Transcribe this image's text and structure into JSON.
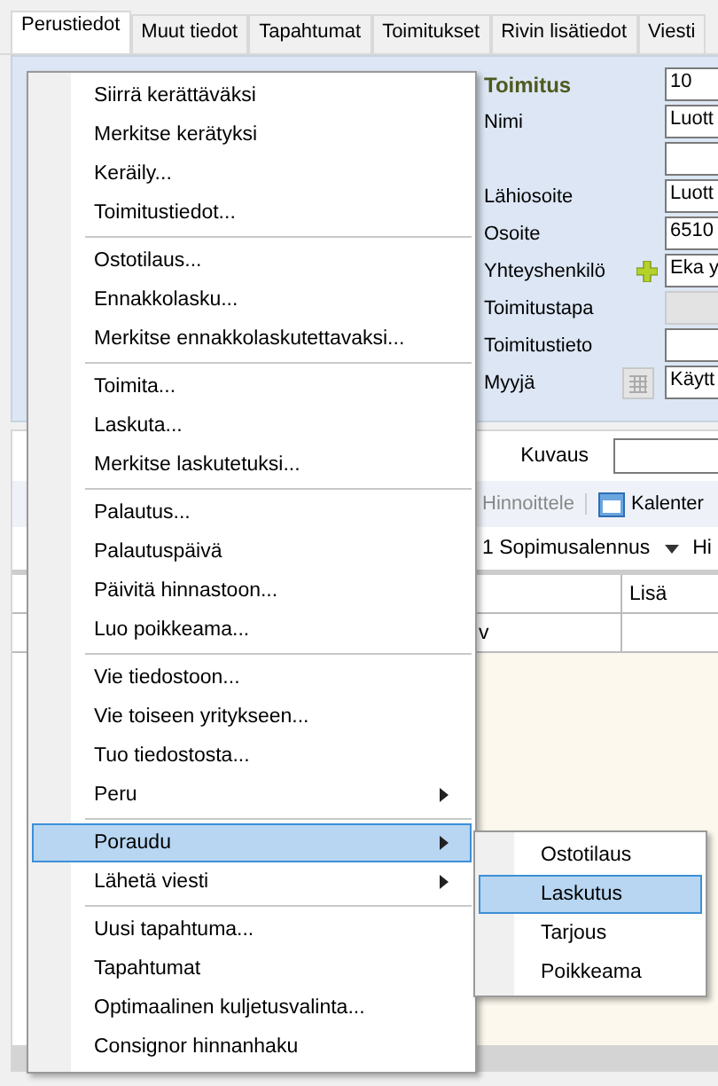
{
  "tabs": [
    {
      "label": "Perustiedot",
      "selected": true
    },
    {
      "label": "Muut tiedot",
      "selected": false
    },
    {
      "label": "Tapahtumat",
      "selected": false
    },
    {
      "label": "Toimitukset",
      "selected": false
    },
    {
      "label": "Rivin lisätiedot",
      "selected": false
    },
    {
      "label": "Viesti",
      "selected": false
    }
  ],
  "form": [
    {
      "label": "Toimitus",
      "kind": "heading",
      "value": "10"
    },
    {
      "label": "Nimi",
      "kind": "text",
      "value": "Luott"
    },
    {
      "kind": "text"
    },
    {
      "label": "Lähiosoite",
      "kind": "text",
      "value": "Luott"
    },
    {
      "label": "Osoite",
      "kind": "text",
      "value": "6510"
    },
    {
      "label": "Yhteyshenkilö",
      "kind": "add",
      "value": "Eka y"
    },
    {
      "label": "Toimitustapa",
      "kind": "disabled"
    },
    {
      "label": "Toimitustieto",
      "kind": "text"
    },
    {
      "label": "Myyjä",
      "kind": "picker",
      "value": "Käytt"
    }
  ],
  "description": {
    "label": "Kuvaus"
  },
  "toolbar": [
    {
      "label": "Hinnoittele",
      "kind": "disabled"
    },
    {
      "label": "Kalenter",
      "kind": "calendar"
    }
  ],
  "filter": {
    "value": "1 Sopimusalennus",
    "next": "Hi"
  },
  "grid": {
    "columns": [
      "Lisä"
    ],
    "rows": [
      [
        "v"
      ]
    ]
  },
  "menu": [
    {
      "kind": "item",
      "label": "Siirrä kerättäväksi",
      "selected": false
    },
    {
      "kind": "item",
      "label": "Merkitse kerätyksi",
      "selected": false
    },
    {
      "kind": "item",
      "label": "Keräily...",
      "selected": false
    },
    {
      "kind": "item",
      "label": "Toimitustiedot...",
      "selected": false
    },
    {
      "kind": "separator"
    },
    {
      "kind": "item",
      "label": "Ostotilaus...",
      "selected": false
    },
    {
      "kind": "item",
      "label": "Ennakkolasku...",
      "selected": false
    },
    {
      "kind": "item",
      "label": "Merkitse ennakkolaskutettavaksi...",
      "selected": false
    },
    {
      "kind": "separator"
    },
    {
      "kind": "item",
      "label": "Toimita...",
      "selected": false
    },
    {
      "kind": "item",
      "label": "Laskuta...",
      "selected": false
    },
    {
      "kind": "item",
      "label": "Merkitse laskutetuksi...",
      "selected": false
    },
    {
      "kind": "separator"
    },
    {
      "kind": "item",
      "label": "Palautus...",
      "selected": false
    },
    {
      "kind": "item",
      "label": "Palautuspäivä",
      "selected": false
    },
    {
      "kind": "item",
      "label": "Päivitä hinnastoon...",
      "selected": false
    },
    {
      "kind": "item",
      "label": "Luo poikkeama...",
      "selected": false
    },
    {
      "kind": "separator"
    },
    {
      "kind": "item",
      "label": "Vie tiedostoon...",
      "selected": false
    },
    {
      "kind": "item",
      "label": "Vie toiseen yritykseen...",
      "selected": false
    },
    {
      "kind": "item",
      "label": "Tuo tiedostosta...",
      "selected": false
    },
    {
      "kind": "submenu",
      "label": "Peru",
      "selected": false
    },
    {
      "kind": "separator"
    },
    {
      "kind": "submenu",
      "label": "Poraudu",
      "selected": true
    },
    {
      "kind": "submenu",
      "label": "Lähetä viesti",
      "selected": false
    },
    {
      "kind": "separator"
    },
    {
      "kind": "item",
      "label": "Uusi tapahtuma...",
      "selected": false
    },
    {
      "kind": "item",
      "label": "Tapahtumat",
      "selected": false
    },
    {
      "kind": "item",
      "label": "Optimaalinen kuljetusvalinta...",
      "selected": false
    },
    {
      "kind": "item",
      "label": "Consignor hinnanhaku",
      "selected": false
    }
  ],
  "submenu": [
    {
      "label": "Ostotilaus",
      "selected": false
    },
    {
      "label": "Laskutus",
      "selected": true
    },
    {
      "label": "Tarjous",
      "selected": false
    },
    {
      "label": "Poikkeama",
      "selected": false
    }
  ]
}
